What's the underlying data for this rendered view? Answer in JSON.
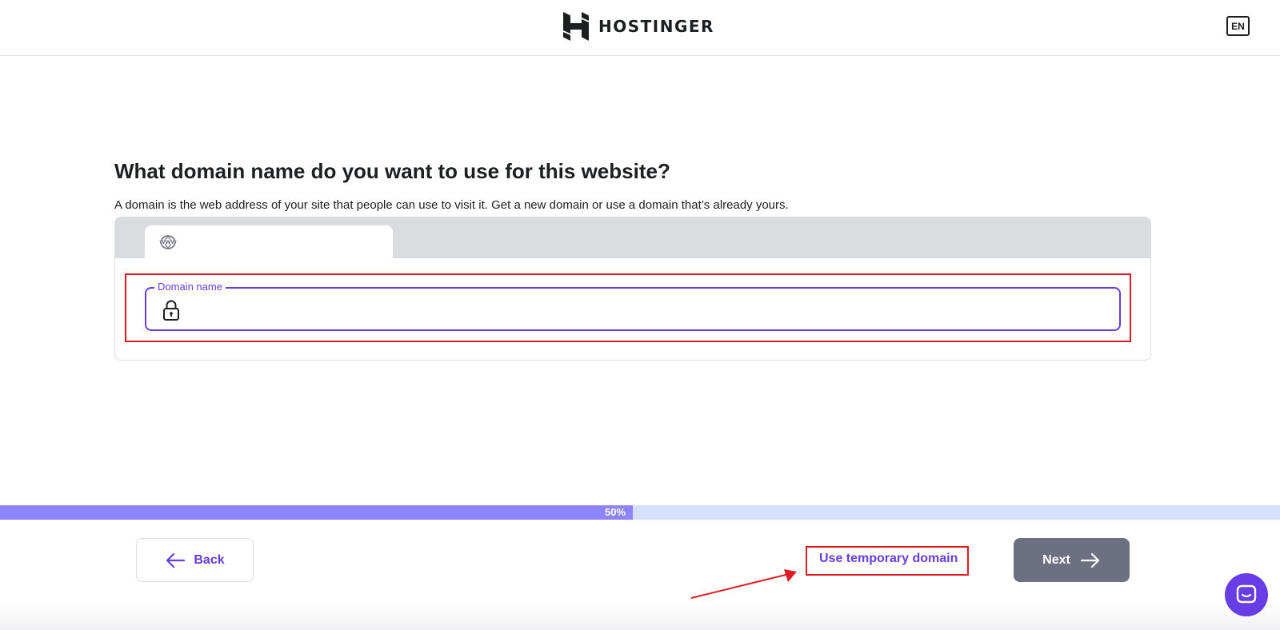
{
  "header": {
    "brand": "HOSTINGER",
    "language": "EN"
  },
  "main": {
    "title": "What domain name do you want to use for this website?",
    "subtitle": "A domain is the web address of your site that people can use to visit it. Get a new domain or use a domain that’s already yours.",
    "tabs": [
      {
        "icon": "www-icon"
      }
    ],
    "domain_field": {
      "label": "Domain name",
      "value": "",
      "placeholder": "",
      "icon": "lock-icon"
    }
  },
  "progress": {
    "percent": 50,
    "label": "50%"
  },
  "footer": {
    "back_label": "Back",
    "temp_domain_label": "Use temporary domain",
    "next_label": "Next"
  },
  "colors": {
    "accent": "#673de6",
    "progress_fill": "#8c85ff",
    "progress_track": "#d5dfff",
    "next_button": "#6d7081",
    "annotation": "#e11b22"
  }
}
